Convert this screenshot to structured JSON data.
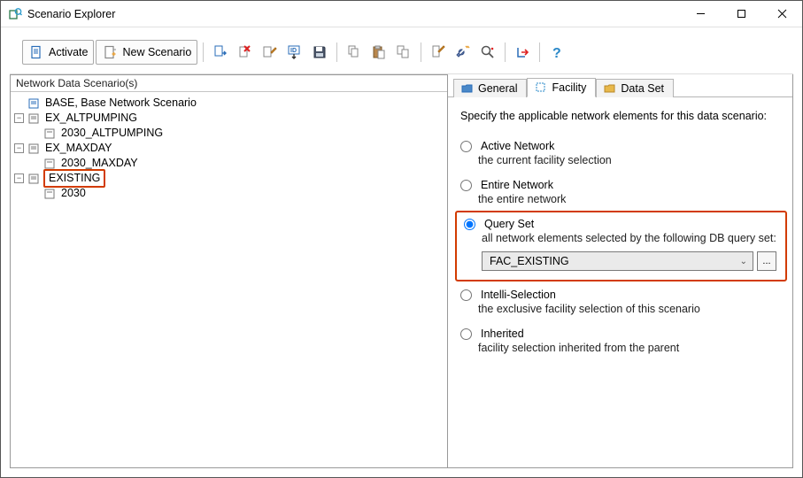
{
  "window": {
    "title": "Scenario Explorer"
  },
  "toolbar": {
    "activate_label": "Activate",
    "newscenario_label": "New Scenario"
  },
  "left": {
    "header": "Network Data Scenario(s)",
    "tree": {
      "n0": "BASE, Base Network Scenario",
      "n1": "EX_ALTPUMPING",
      "n1_0": "2030_ALTPUMPING",
      "n2": "EX_MAXDAY",
      "n2_0": "2030_MAXDAY",
      "n3": "EXISTING",
      "n3_0": "2030"
    }
  },
  "tabs": {
    "general": "General",
    "facility": "Facility",
    "dataset": "Data Set"
  },
  "facility": {
    "desc": "Specify the applicable network elements for this data scenario:",
    "active": {
      "label": "Active Network",
      "sub": "the current facility selection"
    },
    "entire": {
      "label": "Entire Network",
      "sub": "the entire network"
    },
    "query": {
      "label": "Query Set",
      "sub": "all network elements selected by the following DB query set:",
      "dropdown_value": "FAC_EXISTING",
      "more_label": "..."
    },
    "intelli": {
      "label": "Intelli-Selection",
      "sub": "the exclusive facility selection of this scenario"
    },
    "inherited": {
      "label": "Inherited",
      "sub": "facility selection inherited from the parent"
    }
  }
}
